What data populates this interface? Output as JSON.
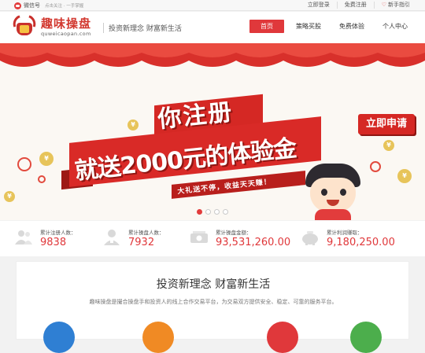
{
  "topbar": {
    "wechat_label": "微信号",
    "wechat_hint": "点击关注 · 一手掌握",
    "login": "立即登录",
    "register": "免费注册",
    "guide": "新手指引"
  },
  "header": {
    "brand": "趣味操盘",
    "domain": "quweicaopan.com",
    "slogan": "投资新理念 财富新生活",
    "nav": [
      "首页",
      "策略买股",
      "免费体验",
      "个人中心"
    ]
  },
  "banner": {
    "headline_line1": "你注册",
    "headline_line2": "就送2000元的体验金",
    "tagline": "大礼送不停，收益天天赚！",
    "cta": "立即申请",
    "coin_symbol": "¥",
    "slides": 4,
    "active_slide": 1
  },
  "stats": [
    {
      "label": "累计注册人数：",
      "value": "9838",
      "icon": "users-icon"
    },
    {
      "label": "累计操盘人数：",
      "value": "7932",
      "icon": "trader-icon"
    },
    {
      "label": "累计操盘金额：",
      "value": "93,531,260.00",
      "icon": "cash-icon"
    },
    {
      "label": "累计利润赚取：",
      "value": "9,180,250.00",
      "icon": "piggy-bank-icon"
    }
  ],
  "section": {
    "title": "投资新理念 财富新生活",
    "desc": "趣味操盘是撮合操盘手和投资人的线上合作交易平台，为交易双方提供安全、稳定、可靠的服务平台。"
  },
  "colors": {
    "accent": "#e0383b",
    "banner_red": "#d52824",
    "gold": "#e7c45a",
    "blue": "#2f7fd3",
    "orange": "#f08a24",
    "green": "#4cae4c"
  }
}
